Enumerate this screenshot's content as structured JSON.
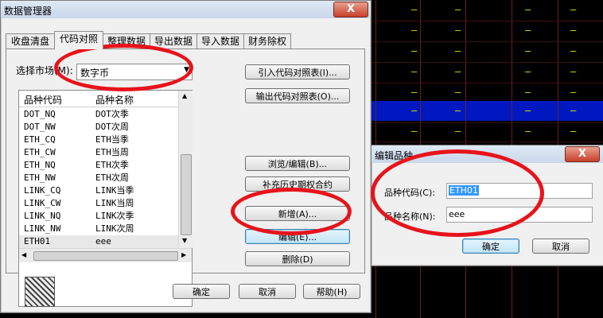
{
  "main_dialog": {
    "title": "数据管理器",
    "close_label": "X",
    "tabs": [
      {
        "label": "收盘清盘"
      },
      {
        "label": "代码对照"
      },
      {
        "label": "整理数据"
      },
      {
        "label": "导出数据"
      },
      {
        "label": "导入数据"
      },
      {
        "label": "财务除权"
      }
    ],
    "market_label": "选择市场(M):",
    "market_value": "数字币",
    "list_headers": [
      "品种代码",
      "品种名称"
    ],
    "rows": [
      {
        "code": "DOT_NQ",
        "name": "DOT次季"
      },
      {
        "code": "DOT_NW",
        "name": "DOT次周"
      },
      {
        "code": "ETH_CQ",
        "name": "ETH当季"
      },
      {
        "code": "ETH_CW",
        "name": "ETH当周"
      },
      {
        "code": "ETH_NQ",
        "name": "ETH次季"
      },
      {
        "code": "ETH_NW",
        "name": "ETH次周"
      },
      {
        "code": "LINK_CQ",
        "name": "LINK当季"
      },
      {
        "code": "LINK_CW",
        "name": "LINK当周"
      },
      {
        "code": "LINK_NQ",
        "name": "LINK次季"
      },
      {
        "code": "LINK_NW",
        "name": "LINK次周"
      },
      {
        "code": "ETH01",
        "name": "eee"
      }
    ],
    "buttons": {
      "import_table": "引入代码对照表(I)...",
      "export_table": "输出代码对照表(O)...",
      "browse_edit": "浏览/编辑(B)...",
      "supplement": "补充历史期权合约",
      "add": "新增(A)...",
      "edit": "编辑(E)...",
      "delete": "删除(D)",
      "ok": "确定",
      "cancel": "取消",
      "help": "帮助(H)"
    }
  },
  "edit_dialog": {
    "title": "编辑品种",
    "code_label": "品种代码(C):",
    "code_value": "ETH01",
    "name_label": "品种名称(N):",
    "name_value": "eee",
    "ok": "确定",
    "cancel": "取消",
    "close_label": "X"
  },
  "colors": {
    "annotation_red": "#e8131b",
    "highlight_blue": "#0018c0",
    "chart_dash": "#e6e600"
  }
}
